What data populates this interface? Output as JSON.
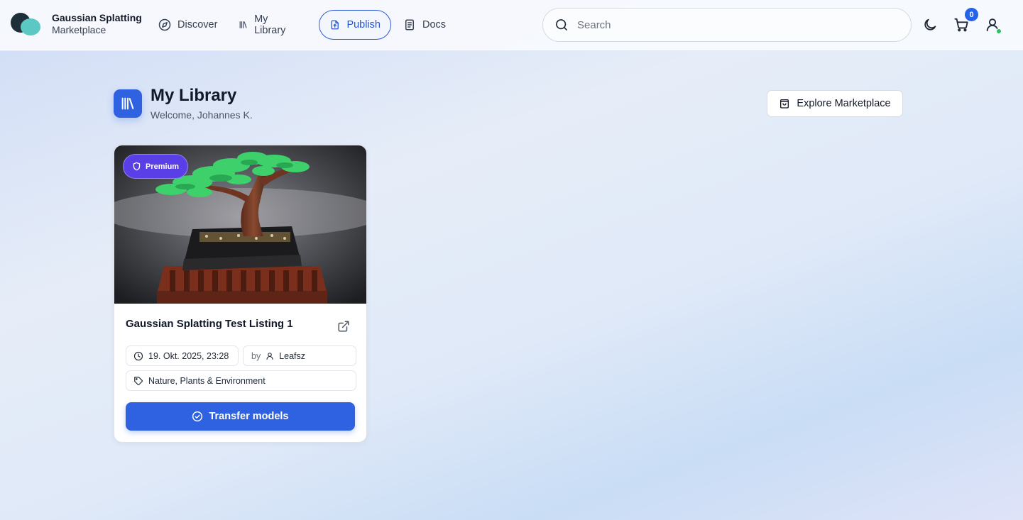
{
  "brand": {
    "title": "Gaussian Splatting",
    "subtitle": "Marketplace"
  },
  "nav": {
    "discover": "Discover",
    "library": "My Library",
    "publish": "Publish",
    "docs": "Docs"
  },
  "search": {
    "placeholder": "Search",
    "value": ""
  },
  "cart": {
    "count": "0"
  },
  "icons": {
    "discover": "compass-icon",
    "library": "library-icon",
    "publish": "file-upload-icon",
    "docs": "document-icon",
    "search": "search-icon",
    "theme": "moon-icon",
    "cart": "cart-icon",
    "user": "user-icon",
    "explore": "shopping-bag-icon",
    "premium": "shield-icon",
    "external": "external-link-icon",
    "date": "clock-icon",
    "author": "user-icon",
    "category": "tag-icon",
    "transfer": "check-circle-icon"
  },
  "page": {
    "title": "My Library",
    "subtitle": "Welcome, Johannes K.",
    "explore_label": "Explore Marketplace"
  },
  "listing": {
    "badge": "Premium",
    "title": "Gaussian Splatting Test Listing 1",
    "date": "19. Okt. 2025, 23:28",
    "by_label": "by",
    "author": "Leafsz",
    "category": "Nature, Plants & Environment",
    "action_label": "Transfer models"
  },
  "colors": {
    "primary": "#2f62e0",
    "premium": "#5a3ee6",
    "online": "#22c55e"
  }
}
